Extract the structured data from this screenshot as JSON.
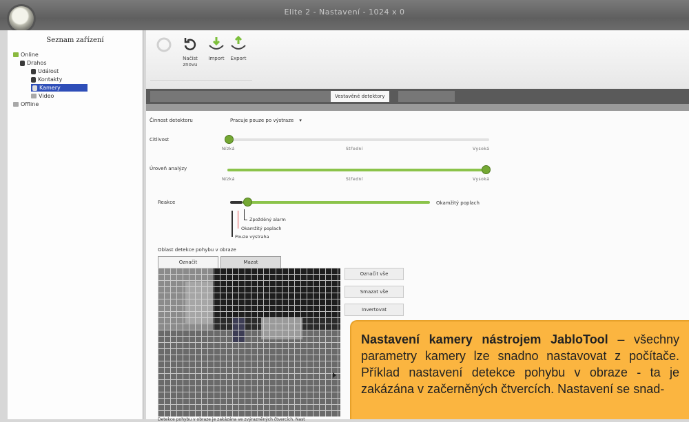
{
  "window": {
    "title": "Elite 2 - Nastavení - 1024 x 0"
  },
  "sidebar": {
    "header": "Seznam zařízení",
    "tree": [
      {
        "label": "Online",
        "icon": "online-folder-icon"
      },
      {
        "label": "Drahos",
        "icon": "device-icon"
      },
      {
        "label": "Událost",
        "icon": "events-icon"
      },
      {
        "label": "Kontakty",
        "icon": "contacts-icon"
      },
      {
        "label": "Kamery",
        "icon": "camera-icon",
        "selected": true
      },
      {
        "label": "Video",
        "icon": "video-icon"
      },
      {
        "label": "Offline",
        "icon": "offline-folder-icon"
      }
    ]
  },
  "toolbar": {
    "buttons": [
      {
        "label": "",
        "icon": "refresh-icon"
      },
      {
        "label": "Načíst znovu",
        "icon": "reload-icon"
      },
      {
        "label": "Import",
        "icon": "import-icon"
      },
      {
        "label": "Export",
        "icon": "export-icon"
      }
    ]
  },
  "tabs": {
    "active": "Vestavěné detektory"
  },
  "detector": {
    "cinnost_label": "Činnost detektoru",
    "cinnost_value": "Pracuje pouze po výstraze",
    "citlivost": {
      "label": "Citlivost",
      "value": 0.02,
      "ticks": [
        "Nízká",
        "Střední",
        "Vysoká"
      ]
    },
    "uroven": {
      "label": "Úroveň analýzy",
      "value": 1.0,
      "ticks": [
        "Nízká",
        "Střední",
        "Vysoká"
      ]
    },
    "reakce": {
      "label": "Reakce",
      "value": 0.08,
      "end_label": "Okamžitý poplach",
      "legend": [
        "Zpožděný alarm",
        "Okamžitý poplach",
        "Pouze výstraha"
      ]
    },
    "area_label": "Oblast detekce pohybu v obraze",
    "mark_tab": "Označit",
    "clear_tab": "Mazat",
    "btn_mark_all": "Označit vše",
    "btn_clear_all": "Smazat vše",
    "btn_invert": "Invertovat",
    "footnote": "Detekce pohybu v obraze je zakázána ve zvýrazněných čtvercích. Nast"
  },
  "callout": {
    "bold": "Nastavení kamery nástrojem JabloTool",
    "text": " – všechny parametry kamery lze snadno nastavovat z počítače. Příklad nastavení detekce pohybu v obraze - ta je zakázána v začerněných čtvercích. Nastavení se snad-"
  },
  "colors": {
    "accent_green": "#8bc34a",
    "selection": "#2e4eb8",
    "callout_bg": "#fbb540"
  }
}
